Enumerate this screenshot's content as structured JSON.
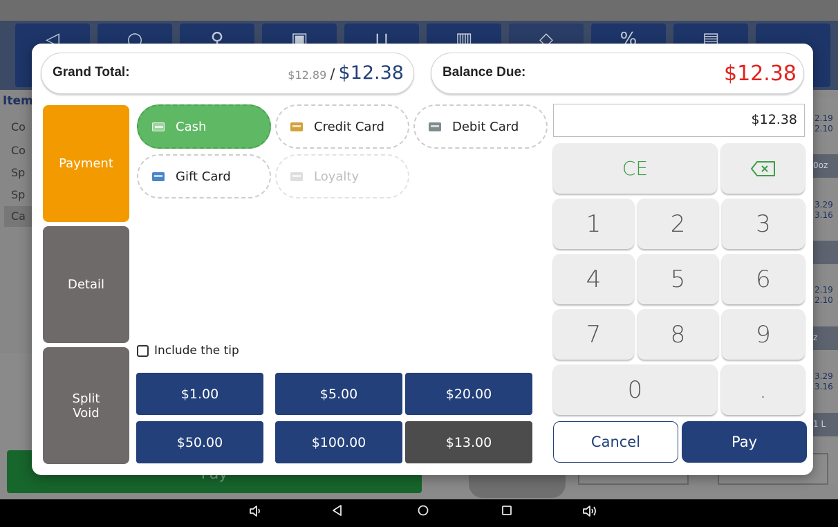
{
  "background": {
    "items_header": "Item",
    "items": [
      "Co",
      "Co",
      "Sp",
      "Sp",
      "Ca"
    ],
    "right_values": [
      "2.19",
      "2.10",
      "0oz",
      "3.29",
      "3.16",
      "2.19",
      "2.10",
      "z",
      "3.29",
      "3.16",
      "1 L"
    ],
    "pay_label": "Pay"
  },
  "modal": {
    "grand_total": {
      "label": "Grand Total:",
      "original": "$12.89",
      "separator": "/",
      "value": "$12.38"
    },
    "balance_due": {
      "label": "Balance Due:",
      "value": "$12.38"
    },
    "side_tabs": [
      {
        "label": "Payment",
        "active": true
      },
      {
        "label": "Detail",
        "active": false
      },
      {
        "label": "Split\nVoid",
        "active": false
      }
    ],
    "payment_methods": [
      {
        "label": "Cash",
        "icon": "cash-icon",
        "state": "selected"
      },
      {
        "label": "Credit Card",
        "icon": "credit-card-icon",
        "state": "normal"
      },
      {
        "label": "Debit Card",
        "icon": "debit-card-icon",
        "state": "normal"
      },
      {
        "label": "Gift Card",
        "icon": "gift-card-icon",
        "state": "normal"
      },
      {
        "label": "Loyalty",
        "icon": "loyalty-card-icon",
        "state": "disabled"
      }
    ],
    "include_tip": {
      "label": "Include the tip",
      "checked": false
    },
    "quick_amounts": [
      "$1.00",
      "$5.00",
      "$20.00",
      "$50.00",
      "$100.00",
      "$13.00"
    ],
    "amount_input": "$12.38",
    "keypad": {
      "ce": "CE",
      "digits": [
        "1",
        "2",
        "3",
        "4",
        "5",
        "6",
        "7",
        "8",
        "9",
        "0",
        "."
      ]
    },
    "cancel_label": "Cancel",
    "pay_label": "Pay"
  },
  "colors": {
    "primary_navy": "#23407a",
    "orange_active": "#f39a00",
    "green_selected": "#5fb864",
    "balance_red": "#e0231d",
    "tab_gray": "#6e6a69"
  },
  "navbar_icons": [
    "volume-down-icon",
    "back-icon",
    "home-icon",
    "recents-icon",
    "volume-up-icon"
  ]
}
